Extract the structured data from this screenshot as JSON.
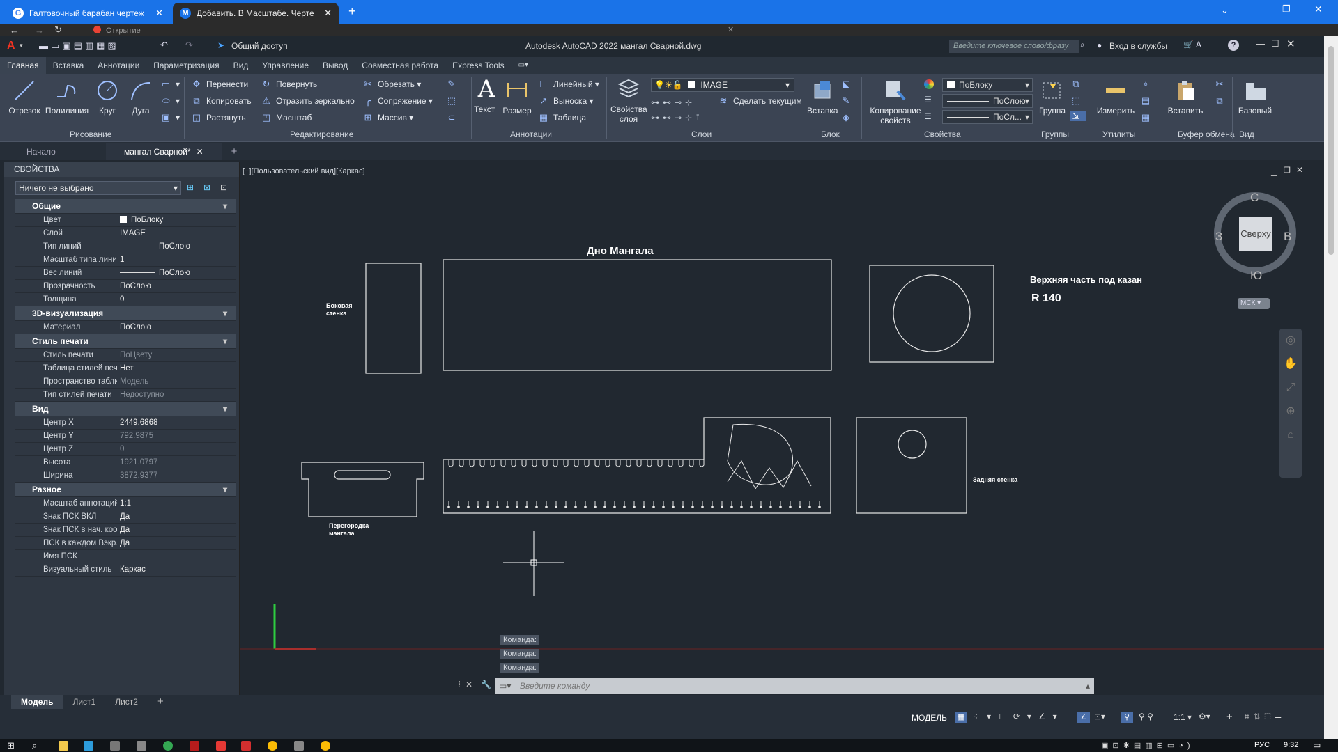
{
  "browser": {
    "tabs": [
      {
        "label": "Галтовочный барабан чертеж",
        "icon": "G"
      },
      {
        "label": "Добавить. В Масштабе. Черте",
        "icon": "M"
      }
    ],
    "loading_label": "Открытие"
  },
  "app": {
    "title": "Autodesk AutoCAD 2022   мангал Сварной.dwg",
    "share_label": "Общий доступ",
    "search_placeholder": "Введите ключевое слово/фразу",
    "signin_label": "Вход в службы"
  },
  "ribbon_tabs": [
    "Главная",
    "Вставка",
    "Аннотации",
    "Параметризация",
    "Вид",
    "Управление",
    "Вывод",
    "Совместная работа",
    "Express Tools"
  ],
  "ribbon": {
    "draw": {
      "line": "Отрезок",
      "polyline": "Полилиния",
      "circle": "Круг",
      "arc": "Дуга",
      "panel": "Рисование"
    },
    "modify": {
      "move": "Перенести",
      "rotate": "Повернуть",
      "trim": "Обрезать",
      "copy": "Копировать",
      "mirror": "Отразить зеркально",
      "fillet": "Сопряжение",
      "stretch": "Растянуть",
      "scale": "Масштаб",
      "array": "Массив",
      "panel": "Редактирование"
    },
    "annotation": {
      "text": "Текст",
      "dim": "Размер",
      "linear": "Линейный",
      "leader": "Выноска",
      "table": "Таблица",
      "panel": "Аннотации"
    },
    "layers": {
      "props": "Свойства слоя",
      "current_layer": "IMAGE",
      "make_current": "Сделать текущим",
      "panel": "Слои"
    },
    "block": {
      "insert": "Вставка",
      "panel": "Блок"
    },
    "properties": {
      "match": "Копирование свойств",
      "color": "ПоБлоку",
      "linetype": "ПоСлою",
      "lineweight": "ПоСл...",
      "panel": "Свойства"
    },
    "groups": {
      "group": "Группа",
      "panel": "Группы"
    },
    "utilities": {
      "measure": "Измерить",
      "panel": "Утилиты"
    },
    "clipboard": {
      "paste": "Вставить",
      "panel": "Буфер обмена"
    },
    "view": {
      "base": "Базовый",
      "panel": "Вид"
    }
  },
  "doc_tabs": [
    "Начало",
    "мангал Сварной*"
  ],
  "properties": {
    "title": "СВОЙСТВА",
    "selection": "Ничего не выбрано",
    "sections": [
      {
        "name": "Общие",
        "rows": [
          [
            "Цвет",
            "ПоБлоку"
          ],
          [
            "Слой",
            "IMAGE"
          ],
          [
            "Тип линий",
            "ПоСлою"
          ],
          [
            "Масштаб типа линий",
            "1"
          ],
          [
            "Вес линий",
            "ПоСлою"
          ],
          [
            "Прозрачность",
            "ПоСлою"
          ],
          [
            "Толщина",
            "0"
          ]
        ]
      },
      {
        "name": "3D-визуализация",
        "rows": [
          [
            "Материал",
            "ПоСлою"
          ]
        ]
      },
      {
        "name": "Стиль печати",
        "rows": [
          [
            "Стиль печати",
            "ПоЦвету"
          ],
          [
            "Таблица стилей печ...",
            "Нет"
          ],
          [
            "Пространство табли...",
            "Модель"
          ],
          [
            "Тип стилей печати",
            "Недоступно"
          ]
        ]
      },
      {
        "name": "Вид",
        "rows": [
          [
            "Центр X",
            "2449.6868"
          ],
          [
            "Центр Y",
            "792.9875"
          ],
          [
            "Центр Z",
            "0"
          ],
          [
            "Высота",
            "1921.0797"
          ],
          [
            "Ширина",
            "3872.9377"
          ]
        ]
      },
      {
        "name": "Разное",
        "rows": [
          [
            "Масштаб аннотаций",
            "1:1"
          ],
          [
            "Знак ПСК ВКЛ",
            "Да"
          ],
          [
            "Знак ПСК в нач. коо...",
            "Да"
          ],
          [
            "ПСК в каждом Вэкр...",
            "Да"
          ],
          [
            "Имя ПСК",
            ""
          ],
          [
            "Визуальный стиль",
            "Каркас"
          ]
        ]
      }
    ]
  },
  "viewport": {
    "label": "[−][Пользовательский вид][Каркас]"
  },
  "drawing": {
    "title_bottom": "Дно Мангала",
    "side_wall": "Боковая стенка",
    "top_part": "Верхняя часть под казан",
    "radius": "R 140",
    "partition": "Перегородка мангала",
    "back_wall": "Задняя стенка"
  },
  "viewcube": {
    "top": "Сверху",
    "north": "С",
    "south": "Ю",
    "west": "З",
    "east": "В",
    "wcs": "МСК"
  },
  "command": {
    "history": [
      "Команда:",
      "Команда:",
      "Команда:"
    ],
    "placeholder": "Введите команду"
  },
  "layout_tabs": [
    "Модель",
    "Лист1",
    "Лист2"
  ],
  "status": {
    "model": "МОДЕЛЬ",
    "scale": "1:1"
  },
  "taskbar": {
    "lang": "РУС",
    "time": "9:32"
  }
}
